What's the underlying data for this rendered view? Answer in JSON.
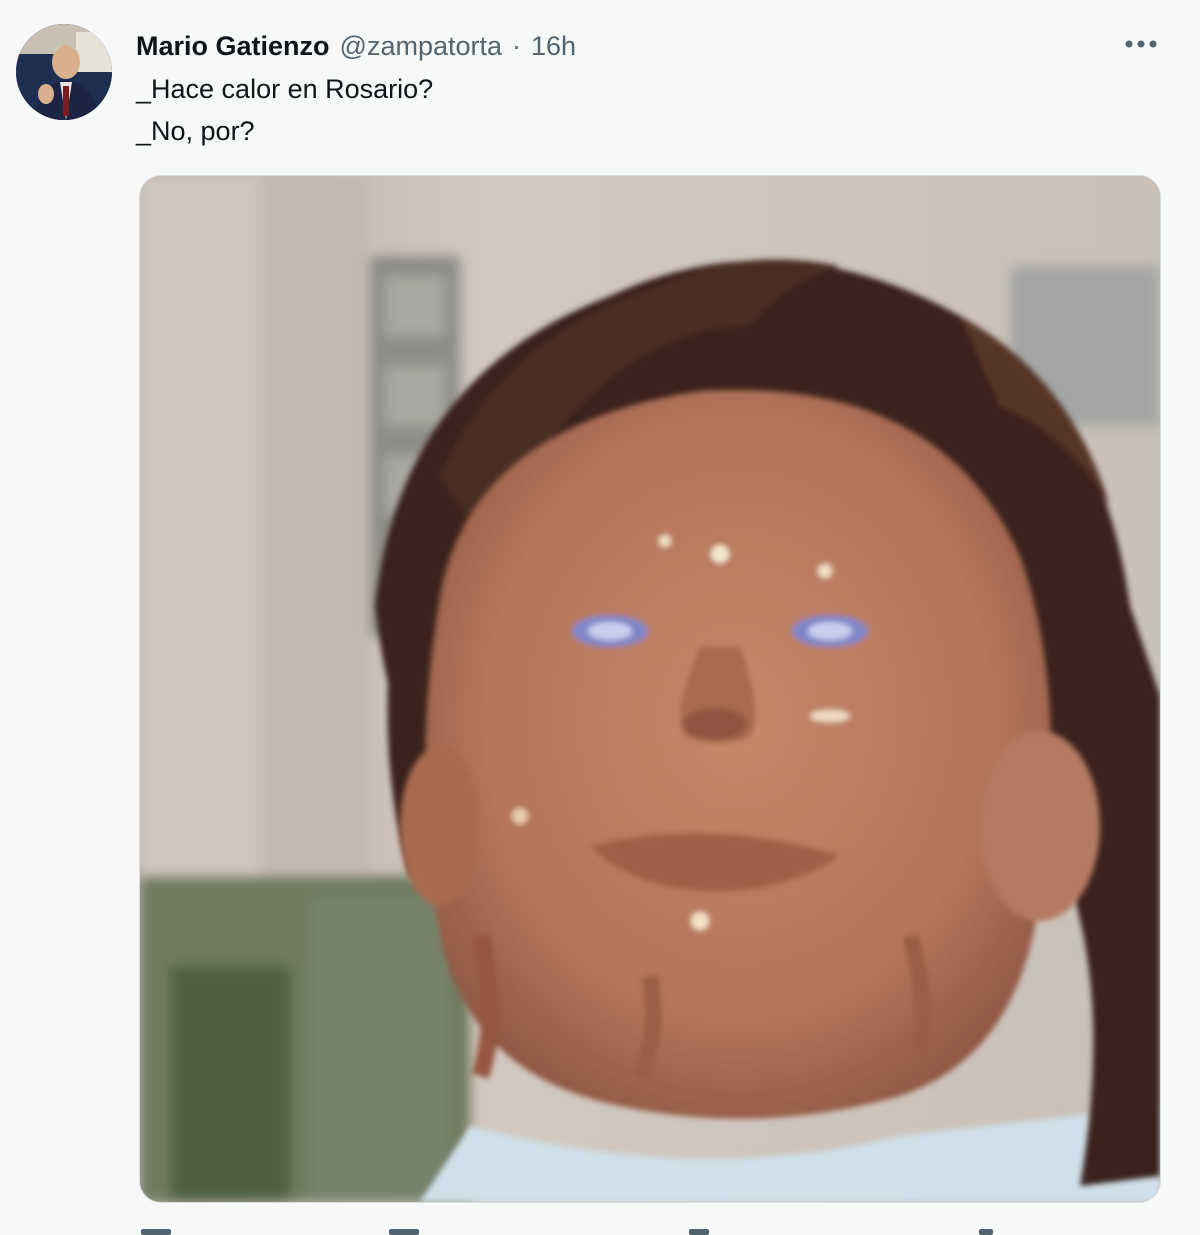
{
  "tweet": {
    "author_name": "Mario Gatienzo",
    "author_handle": "@zampatorta",
    "separator": "·",
    "timestamp": "16h",
    "lines": [
      "_Hace calor en Rosario?",
      "_No, por?"
    ]
  },
  "icons": {
    "more": "more-horizontal-icon",
    "reply": "reply-icon",
    "retweet": "retweet-icon",
    "like": "like-icon",
    "share": "share-icon"
  },
  "colors": {
    "background": "#f7f8f8",
    "text_primary": "#0f1419",
    "text_secondary": "#536471"
  }
}
